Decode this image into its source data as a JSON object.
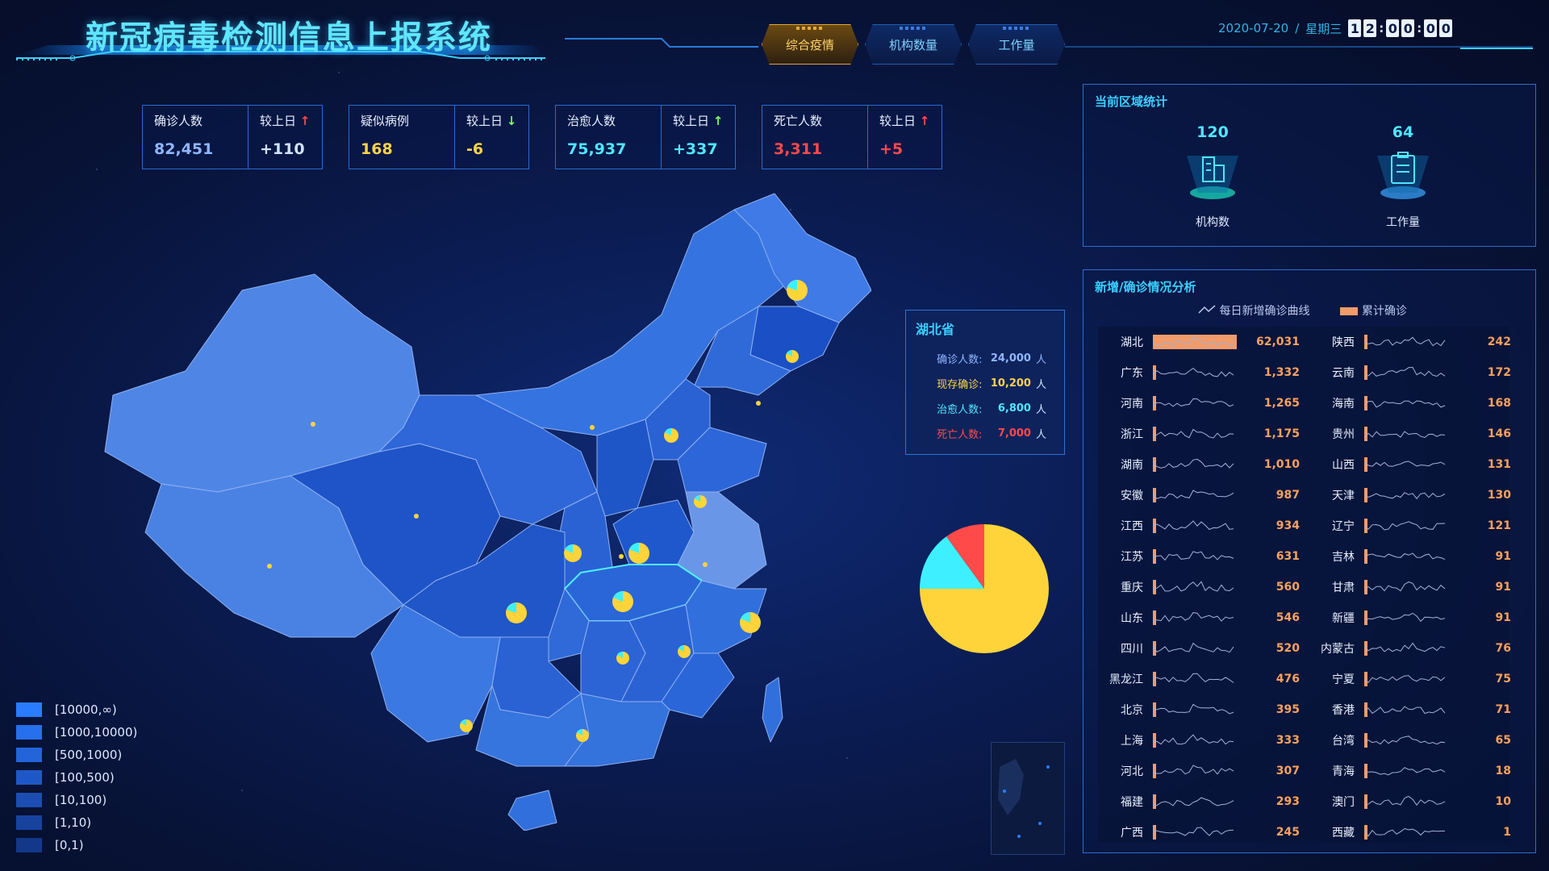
{
  "header": {
    "title": "新冠病毒检测信息上报系统",
    "tabs": [
      {
        "label": "综合疫情",
        "active": true
      },
      {
        "label": "机构数量",
        "active": false
      },
      {
        "label": "工作量",
        "active": false
      }
    ],
    "date": "2020-07-20",
    "sep": "/",
    "weekday": "星期三",
    "time_digits": [
      "1",
      "2",
      "0",
      "0",
      "0",
      "0"
    ]
  },
  "stats": [
    {
      "label": "确诊人数",
      "value": "82,451",
      "cmp_label": "较上日",
      "cmp_value": "+110",
      "trend": "up",
      "value_color": "#8fb6ff",
      "cmp_color": "#cfe3ff"
    },
    {
      "label": "疑似病例",
      "value": "168",
      "cmp_label": "较上日",
      "cmp_value": "-6",
      "trend": "down",
      "value_color": "#ffd34a",
      "cmp_color": "#ffd34a"
    },
    {
      "label": "治愈人数",
      "value": "75,937",
      "cmp_label": "较上日",
      "cmp_value": "+337",
      "trend": "up",
      "value_color": "#4fe6ff",
      "cmp_color": "#4fe6ff"
    },
    {
      "label": "死亡人数",
      "value": "3,311",
      "cmp_label": "较上日",
      "cmp_value": "+5",
      "trend": "up",
      "value_color": "#ff4a4a",
      "cmp_color": "#ff4a4a"
    }
  ],
  "tooltip": {
    "province": "湖北省",
    "unit": "人",
    "rows": [
      {
        "label": "确诊人数:",
        "value": "24,000",
        "color": "#8fb6ff"
      },
      {
        "label": "现存确诊:",
        "value": "10,200",
        "color": "#ffd34a"
      },
      {
        "label": "治愈人数:",
        "value": "6,800",
        "color": "#4fe6ff"
      },
      {
        "label": "死亡人数:",
        "value": "7,000",
        "color": "#ff4a4a"
      }
    ]
  },
  "pie": {
    "slices": [
      {
        "value": 0.75,
        "color": "#ffd43a"
      },
      {
        "value": 0.15,
        "color": "#3ef0ff"
      },
      {
        "value": 0.1,
        "color": "#ff4a4a"
      }
    ]
  },
  "legend": [
    {
      "label": "[10000,∞)",
      "color": "#2a7cff"
    },
    {
      "label": "[1000,10000)",
      "color": "#2670ee"
    },
    {
      "label": "[500,1000)",
      "color": "#2364da"
    },
    {
      "label": "[100,500)",
      "color": "#1f58c6"
    },
    {
      "label": "[10,100)",
      "color": "#1b4db2"
    },
    {
      "label": "[1,10)",
      "color": "#17429e"
    },
    {
      "label": "[0,1)",
      "color": "#13388a"
    }
  ],
  "region_panel": {
    "title": "当前区域统计",
    "items": [
      {
        "value": "120",
        "caption": "机构数",
        "icon": "building-icon"
      },
      {
        "value": "64",
        "caption": "工作量",
        "icon": "clipboard-icon"
      }
    ]
  },
  "analysis_panel": {
    "title": "新增/确诊情况分析",
    "legend_line": "每日新增确诊曲线",
    "legend_bar": "累计确诊",
    "left": [
      {
        "name": "湖北",
        "value": "62,031",
        "num": 62031
      },
      {
        "name": "广东",
        "value": "1,332",
        "num": 1332
      },
      {
        "name": "河南",
        "value": "1,265",
        "num": 1265
      },
      {
        "name": "浙江",
        "value": "1,175",
        "num": 1175
      },
      {
        "name": "湖南",
        "value": "1,010",
        "num": 1010
      },
      {
        "name": "安徽",
        "value": "987",
        "num": 987
      },
      {
        "name": "江西",
        "value": "934",
        "num": 934
      },
      {
        "name": "江苏",
        "value": "631",
        "num": 631
      },
      {
        "name": "重庆",
        "value": "560",
        "num": 560
      },
      {
        "name": "山东",
        "value": "546",
        "num": 546
      },
      {
        "name": "四川",
        "value": "520",
        "num": 520
      },
      {
        "name": "黑龙江",
        "value": "476",
        "num": 476
      },
      {
        "name": "北京",
        "value": "395",
        "num": 395
      },
      {
        "name": "上海",
        "value": "333",
        "num": 333
      },
      {
        "name": "河北",
        "value": "307",
        "num": 307
      },
      {
        "name": "福建",
        "value": "293",
        "num": 293
      },
      {
        "name": "广西",
        "value": "245",
        "num": 245
      }
    ],
    "right": [
      {
        "name": "陕西",
        "value": "242",
        "num": 242
      },
      {
        "name": "云南",
        "value": "172",
        "num": 172
      },
      {
        "name": "海南",
        "value": "168",
        "num": 168
      },
      {
        "name": "贵州",
        "value": "146",
        "num": 146
      },
      {
        "name": "山西",
        "value": "131",
        "num": 131
      },
      {
        "name": "天津",
        "value": "130",
        "num": 130
      },
      {
        "name": "辽宁",
        "value": "121",
        "num": 121
      },
      {
        "name": "吉林",
        "value": "91",
        "num": 91
      },
      {
        "name": "甘肃",
        "value": "91",
        "num": 91
      },
      {
        "name": "新疆",
        "value": "91",
        "num": 91
      },
      {
        "name": "内蒙古",
        "value": "76",
        "num": 76
      },
      {
        "name": "宁夏",
        "value": "75",
        "num": 75
      },
      {
        "name": "香港",
        "value": "71",
        "num": 71
      },
      {
        "name": "台湾",
        "value": "65",
        "num": 65
      },
      {
        "name": "青海",
        "value": "18",
        "num": 18
      },
      {
        "name": "澳门",
        "value": "10",
        "num": 10
      },
      {
        "name": "西藏",
        "value": "1",
        "num": 1
      }
    ]
  }
}
